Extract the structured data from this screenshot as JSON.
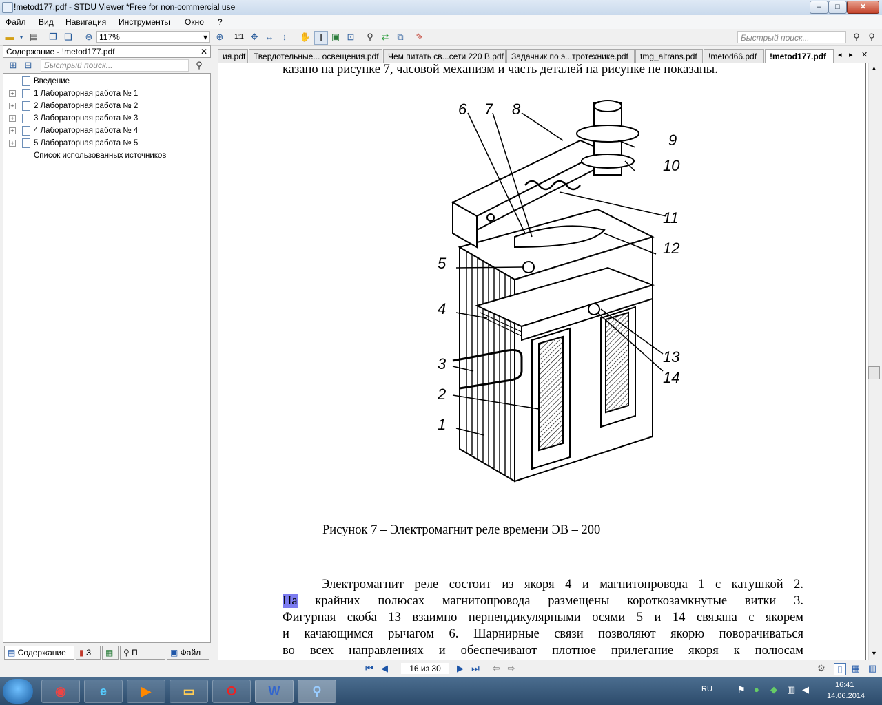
{
  "window": {
    "title": "!metod177.pdf - STDU Viewer *Free for non-commercial use",
    "minimize": "–",
    "maximize": "□",
    "close": "✕"
  },
  "menu": [
    "Файл",
    "Вид",
    "Навигация",
    "Инструменты",
    "Окно",
    "?"
  ],
  "toolbar": {
    "zoom": "117%",
    "zoom_dropdown": "▾",
    "actual_size": "1:1",
    "quick_search_placeholder": "Быстрый поиск..."
  },
  "sidebar": {
    "header": "Содержание - !metod177.pdf",
    "close": "✕",
    "search_placeholder": "Быстрый поиск...",
    "items": [
      {
        "label": "Введение",
        "expandable": false
      },
      {
        "label": "1 Лабораторная работа № 1",
        "expandable": true
      },
      {
        "label": "2 Лабораторная работа № 2",
        "expandable": true
      },
      {
        "label": "3 Лабораторная работа № 3",
        "expandable": true
      },
      {
        "label": "4 Лабораторная работа № 4",
        "expandable": true
      },
      {
        "label": "5 Лабораторная работа № 5",
        "expandable": true
      },
      {
        "label": "Список использованных источников",
        "expandable": false
      }
    ],
    "tabs": [
      {
        "label": "Содержание",
        "active": true
      },
      {
        "label": "З",
        "active": false
      },
      {
        "label": "",
        "active": false
      },
      {
        "label": "П",
        "active": false
      },
      {
        "label": "Файл",
        "active": false
      }
    ]
  },
  "doc_tabs": [
    {
      "label": "ия.pdf",
      "active": false
    },
    {
      "label": "Твердотельные... освещения.pdf",
      "active": false
    },
    {
      "label": "Чем питать св...сети 220 В.pdf",
      "active": false
    },
    {
      "label": "Задачник по э...тротехнике.pdf",
      "active": false
    },
    {
      "label": "tmg_altrans.pdf",
      "active": false
    },
    {
      "label": "!metod66.pdf",
      "active": false
    },
    {
      "label": "!metod177.pdf",
      "active": true
    }
  ],
  "tab_nav": {
    "prev": "◂",
    "next": "▸",
    "close": "✕"
  },
  "document": {
    "top_line": "казано на рисунке 7, часовой механизм и часть деталей на рисунке не показаны.",
    "figure_labels": [
      "6",
      "7",
      "8",
      "9",
      "10",
      "11",
      "12",
      "5",
      "4",
      "13",
      "14",
      "3",
      "2",
      "1"
    ],
    "caption": "Рисунок 7 – Электромагнит реле времени ЭВ – 200",
    "paragraph_lines": [
      "Электромагнит реле состоит из якоря 4 и магнитопровода 1 с катушкой 2.",
      "На крайних полюсах магнитопровода размещены короткозамкнутые витки 3.",
      "Фигурная скоба 13 взаимно перпендикулярными осями 5 и 14 связана с якорем",
      "и качающимся рычагом 6. Шарнирные связи позволяют якорю поворачиваться",
      "во всех направлениях и обеспечивают плотное прилегание якоря к полюсам"
    ],
    "highlighted_text": "На"
  },
  "navigation": {
    "page_indicator": "16 из 30",
    "first": "⏮",
    "prev": "◀",
    "next": "▶",
    "last": "⏭",
    "back": "⇦",
    "forward": "⇨"
  },
  "taskbar": {
    "apps": [
      "chrome",
      "internet-explorer",
      "media-player",
      "file-explorer",
      "opera",
      "word",
      "stdu-viewer"
    ],
    "language": "RU",
    "time": "16:41",
    "date": "14.06.2014"
  },
  "colors": {
    "highlight": "#7c7cf0",
    "titlebar": "#c9d9ec",
    "taskbar": "#2c4b6b"
  }
}
